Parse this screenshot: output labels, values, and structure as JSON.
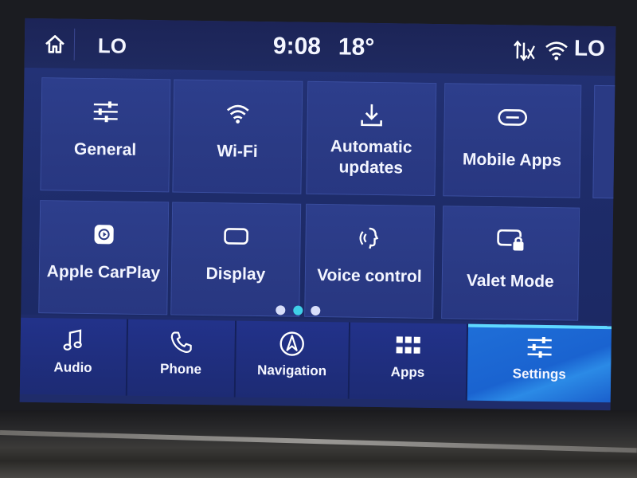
{
  "status_bar": {
    "left_temp_setting": "LO",
    "time": "9:08",
    "outside_temp": "18°",
    "right_temp_setting": "LO",
    "icons": [
      "home-icon",
      "data-signal-icon",
      "wifi-icon"
    ]
  },
  "tiles": [
    {
      "label": "General",
      "icon": "sliders-icon"
    },
    {
      "label": "Wi-Fi",
      "icon": "wifi-icon"
    },
    {
      "label": "Automatic updates",
      "icon": "download-icon"
    },
    {
      "label": "Mobile Apps",
      "icon": "link-icon"
    },
    {
      "label": "Apple CarPlay",
      "icon": "carplay-icon"
    },
    {
      "label": "Display",
      "icon": "display-icon"
    },
    {
      "label": "Voice control",
      "icon": "voice-icon"
    },
    {
      "label": "Valet Mode",
      "icon": "valet-lock-icon"
    }
  ],
  "pager": {
    "pages": 3,
    "current": 2
  },
  "nav": [
    {
      "label": "Audio",
      "icon": "music-note-icon"
    },
    {
      "label": "Phone",
      "icon": "phone-icon"
    },
    {
      "label": "Navigation",
      "icon": "compass-icon"
    },
    {
      "label": "Apps",
      "icon": "apps-grid-icon"
    },
    {
      "label": "Settings",
      "icon": "sliders-icon"
    }
  ],
  "active_nav": "Settings",
  "colors": {
    "screen_bg": "#1e2c6a",
    "tile_bg": "#2a3a84",
    "active_nav": "#1f6fd8",
    "pager_active": "#3fd0e8"
  }
}
